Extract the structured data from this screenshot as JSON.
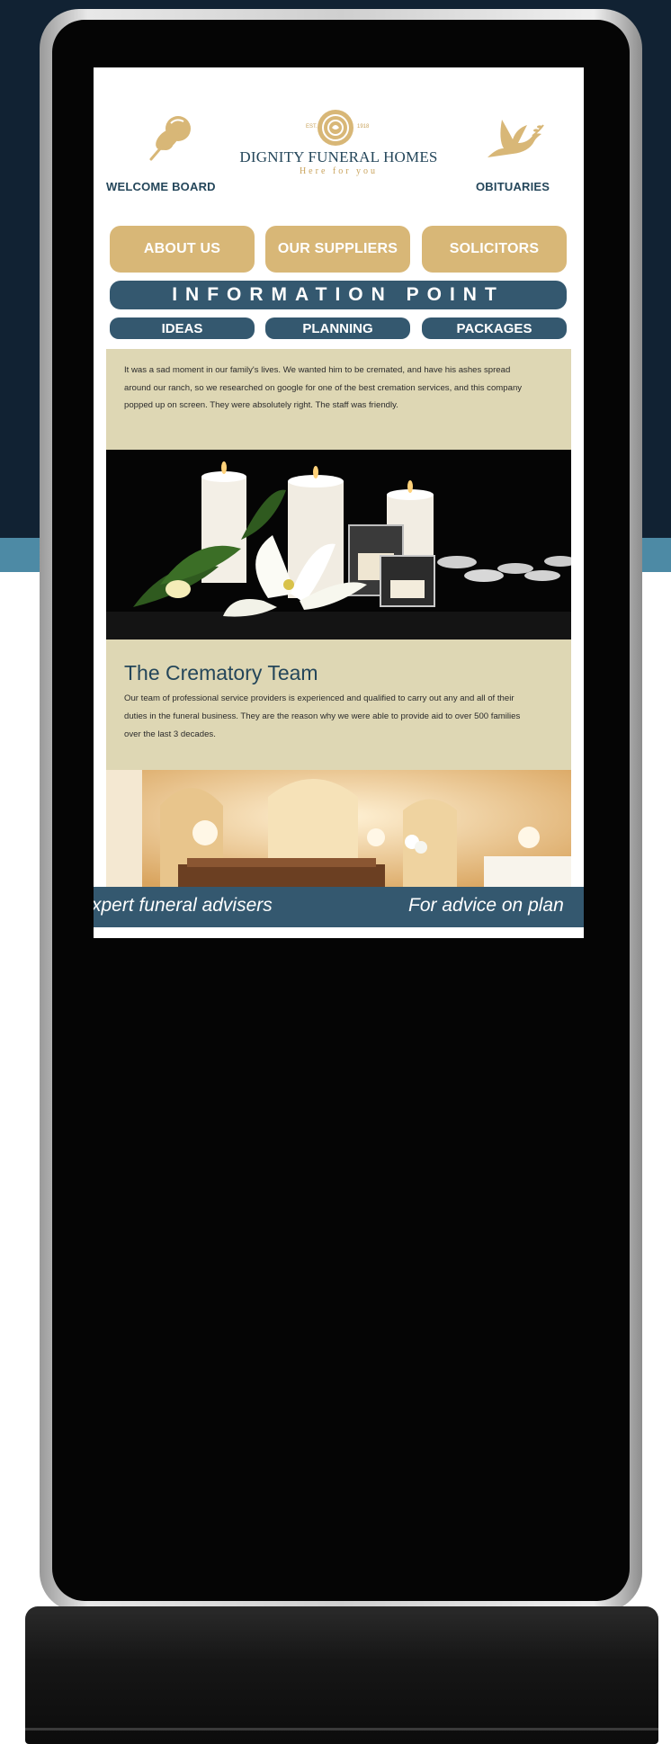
{
  "header": {
    "welcome_label": "WELCOME BOARD",
    "obituaries_label": "OBITUARIES",
    "brand_name": "DIGNITY FUNERAL HOMES",
    "brand_tagline": "Here for you",
    "brand_est": "EST.",
    "brand_year": "1918"
  },
  "nav": {
    "about": "ABOUT US",
    "suppliers": "OUR SUPPLIERS",
    "solicitors": "SOLICITORS",
    "info_point": "INFORMATION POINT",
    "ideas": "IDEAS",
    "planning": "PLANNING",
    "packages": "PACKAGES"
  },
  "testimonial": {
    "text": "It was a sad moment in our family's lives. We wanted him to be cremated, and have his ashes spread around our ranch, so we researched on google for one of the best cremation services, and this company popped up on screen. They were absolutely right. The staff was friendly."
  },
  "team": {
    "title": "The Crematory Team",
    "text": "Our team of professional service providers is experienced and qualified to carry out any and all of their duties in the funeral business. They are the reason why we were able to provide aid to over 500 families over the last 3 decades."
  },
  "ticker": {
    "item1": "xpert funeral advisers",
    "item2": "For advice on plan"
  },
  "colors": {
    "navy": "#24465a",
    "gold": "#d8b777",
    "slate_blue": "#34586f",
    "beige": "#ded7b4",
    "backdrop": "#112233",
    "band": "#4d8aa5"
  }
}
